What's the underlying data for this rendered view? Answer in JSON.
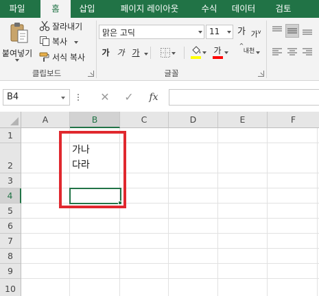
{
  "ribbon_tabs": [
    {
      "label": "파일"
    },
    {
      "label": "홈"
    },
    {
      "label": "삽입"
    },
    {
      "label": "페이지 레이아웃"
    },
    {
      "label": "수식"
    },
    {
      "label": "데이터"
    },
    {
      "label": "검토"
    }
  ],
  "active_tab": "홈",
  "clipboard": {
    "paste_label": "붙여넣기",
    "cut_label": "잘라내기",
    "copy_label": "복사",
    "format_painter_label": "서식 복사",
    "group_label": "클립보드"
  },
  "font": {
    "font_name": "맑은 고딕",
    "font_size": "11",
    "grow_font_glyph": "가",
    "shrink_font_glyph": "가",
    "bold_glyph": "가",
    "italic_glyph": "가",
    "underline_glyph": "가",
    "font_color_glyph": "가",
    "phonetic_glyph": "내천",
    "group_label": "글꼴"
  },
  "formula_bar": {
    "name_box": "B4",
    "fx_label": "fx",
    "formula": ""
  },
  "sheet": {
    "columns": [
      "A",
      "B",
      "C",
      "D",
      "E",
      "F"
    ],
    "rows": [
      "1",
      "2",
      "3",
      "4",
      "5",
      "6",
      "7",
      "8",
      "9",
      "10"
    ],
    "selected_cell": "B4",
    "cells": {
      "B2": "가나\n다라"
    }
  },
  "colors": {
    "accent": "#217346",
    "highlight_box": "#e0282e",
    "fill_color_bar": "#ffff00",
    "font_color_bar": "#ff0000"
  }
}
